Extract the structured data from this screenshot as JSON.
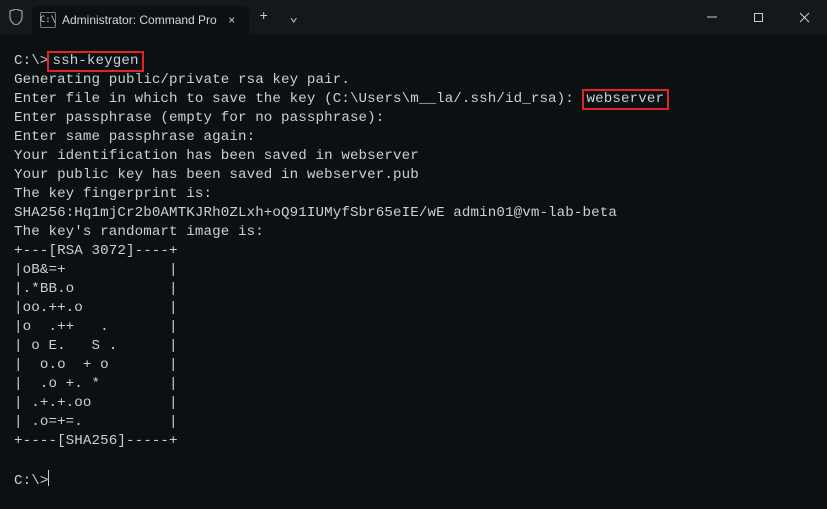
{
  "titlebar": {
    "shield_icon": "shield",
    "tab": {
      "icon_label": "C:\\",
      "title": "Administrator: Command Pro",
      "close": "×"
    },
    "add_tab": "+",
    "chevron": "⌄",
    "win": {
      "min": "—",
      "max": "▢",
      "close": "✕"
    }
  },
  "colors": {
    "highlight": "#e22424"
  },
  "terminal": {
    "prompt1_prefix": "C:\\>",
    "cmd1": "ssh-keygen",
    "line_generating": "Generating public/private rsa key pair.",
    "line_enterfile_prefix": "Enter file in which to save the key (C:\\Users\\m__la/.ssh/id_rsa): ",
    "entered_name": "webserver",
    "line_passphrase": "Enter passphrase (empty for no passphrase):",
    "line_passphrase2": "Enter same passphrase again:",
    "line_idsaved": "Your identification has been saved in webserver",
    "line_pubsaved": "Your public key has been saved in webserver.pub",
    "line_fingerprint_label": "The key fingerprint is:",
    "line_fingerprint": "SHA256:Hq1mjCr2b0AMTKJRh0ZLxh+oQ91IUMyfSbr65eIE/wE admin01@vm-lab-beta",
    "line_randomart_label": "The key's randomart image is:",
    "randomart": [
      "+---[RSA 3072]----+",
      "|oB&=+            |",
      "|.*BB.o           |",
      "|oo.++.o          |",
      "|o  .++   .       |",
      "| o E.   S .      |",
      "|  o.o  + o       |",
      "|  .o +. *        |",
      "| .+.+.oo         |",
      "| .o=+=.          |",
      "+----[SHA256]-----+"
    ],
    "prompt2": "C:\\>"
  }
}
